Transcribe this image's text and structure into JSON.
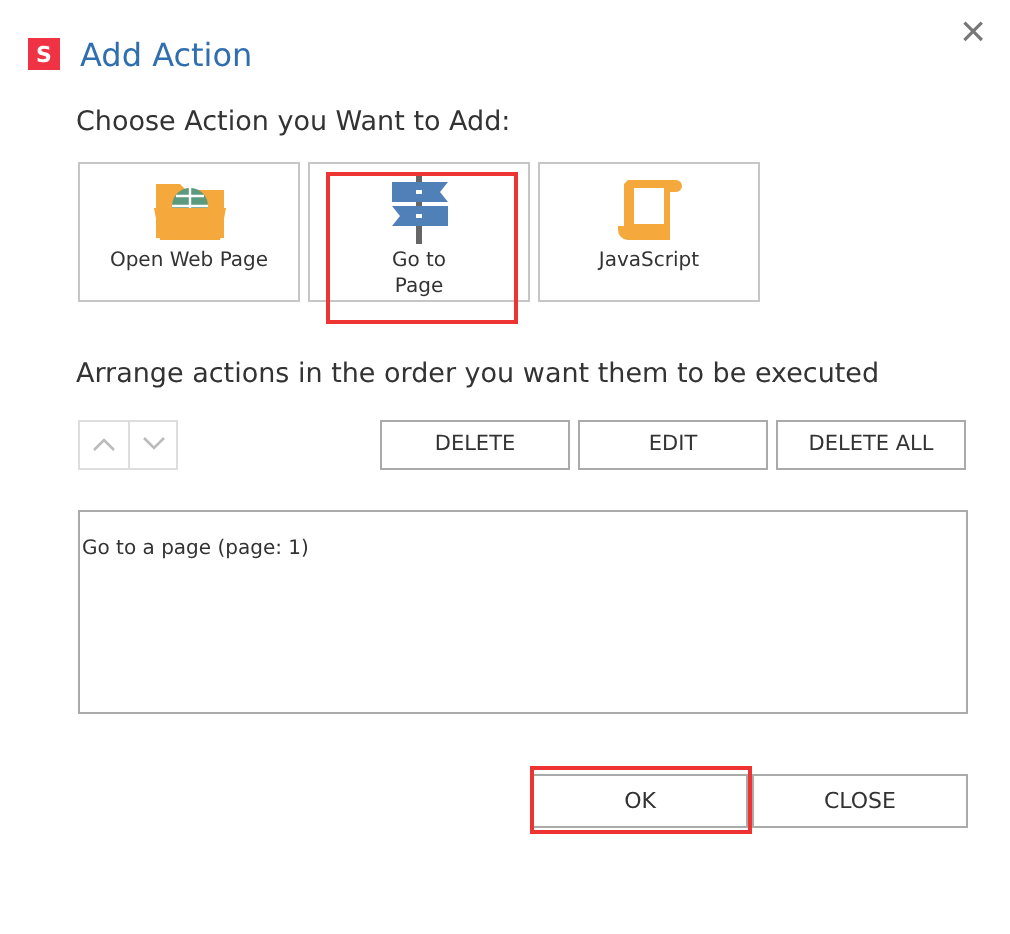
{
  "window": {
    "logo": "S",
    "title": "Add Action",
    "close": "×"
  },
  "choose_label": "Choose Action you Want to Add:",
  "actions": [
    {
      "kind": "web",
      "label": "Open Web Page",
      "highlighted": false
    },
    {
      "kind": "goto",
      "label": "Go to Page",
      "highlighted": true
    },
    {
      "kind": "script",
      "label": "JavaScript",
      "highlighted": false
    }
  ],
  "arrange_label": "Arrange actions in the order you want them to be executed",
  "list_buttons": [
    {
      "label": "DELETE"
    },
    {
      "label": "EDIT"
    },
    {
      "label": "DELETE ALL"
    }
  ],
  "action_list": [
    "Go to a page (page: 1)"
  ],
  "footer_buttons": [
    {
      "label": "OK",
      "highlighted": true
    },
    {
      "label": "CLOSE",
      "highlighted": false
    }
  ]
}
